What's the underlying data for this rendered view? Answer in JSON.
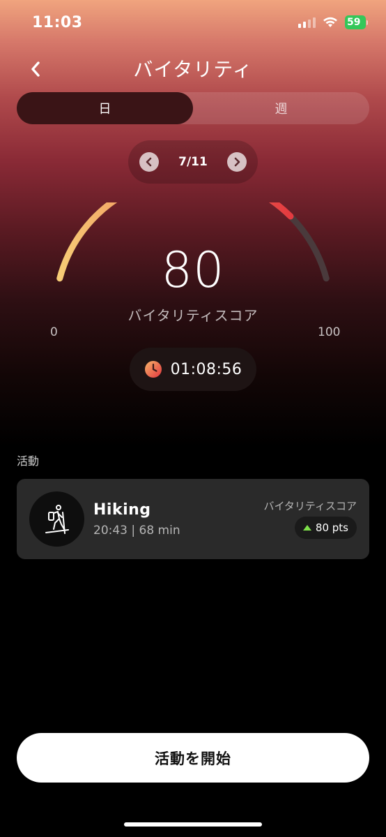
{
  "status_bar": {
    "time": "11:03",
    "battery": "59",
    "battery_color": "#34c759"
  },
  "header": {
    "title": "バイタリティ",
    "back_icon": "chevron-left-icon"
  },
  "tabs": [
    {
      "label": "日",
      "active": true
    },
    {
      "label": "週",
      "active": false
    }
  ],
  "date_nav": {
    "date": "7/11",
    "prev_icon": "chevron-left-icon",
    "next_icon": "chevron-right-icon"
  },
  "gauge": {
    "score": "80",
    "score_value": 80,
    "label": "バイタリティスコア",
    "min": "0",
    "max": "100",
    "min_value": 0,
    "max_value": 100,
    "gradient_start": "#f7cf77",
    "gradient_end": "#e2353e",
    "track_color": "#4a3a3c"
  },
  "timer": {
    "icon": "clock-icon",
    "value": "01:08:56"
  },
  "activity_section": {
    "title": "活動",
    "items": [
      {
        "name": "Hiking",
        "meta": "20:43 | 68 min",
        "icon": "hiking-icon",
        "score_label": "バイタリティスコア",
        "points": "80 pts",
        "points_icon": "triangle-up-icon",
        "points_color": "#7ee04a"
      }
    ]
  },
  "start_button": {
    "label": "活動を開始"
  }
}
